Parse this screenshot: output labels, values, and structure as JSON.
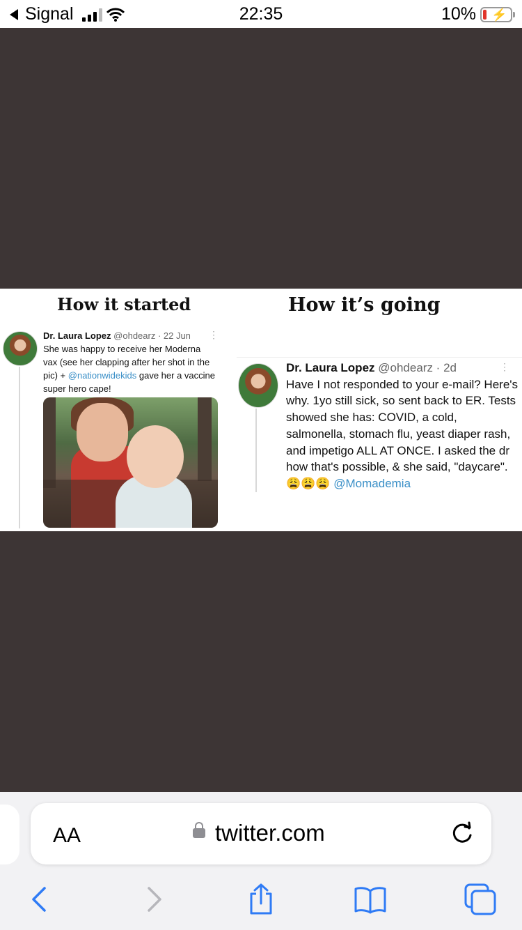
{
  "status": {
    "carrier": "Signal",
    "time": "22:35",
    "battery": "10%"
  },
  "meme": {
    "left_heading": "How it started",
    "right_heading": "How it’s going",
    "left_tweet": {
      "name": "Dr. Laura Lopez",
      "meta": "@ohdearz · 22 Jun",
      "text_before": "She was happy to receive her Moderna vax (see her clapping after her shot in the pic) + ",
      "mention": "@nationwidekids",
      "text_after": " gave her a vaccine super hero cape!"
    },
    "right_tweet": {
      "name": "Dr. Laura Lopez",
      "meta": "@ohdearz · 2d",
      "text": "Have I not responded to your e-mail? Here's why. 1yo still sick, so sent back to ER. Tests showed she has: COVID, a cold, salmonella, stomach flu, yeast diaper rash, and impetigo ALL AT ONCE. I asked the dr how that's possible, & she said, \"daycare\".",
      "emojis": "😩😩😩",
      "mention": "@Momademia"
    }
  },
  "browser": {
    "aa_label": "AA",
    "url": "twitter.com",
    "accent": "#2f7bf5"
  },
  "icons": [
    "back-arrow-icon",
    "signal-bars-icon",
    "wifi-icon",
    "battery-icon",
    "lock-icon",
    "reload-icon",
    "back-icon",
    "forward-icon",
    "share-icon",
    "bookmarks-icon",
    "tabs-icon"
  ]
}
